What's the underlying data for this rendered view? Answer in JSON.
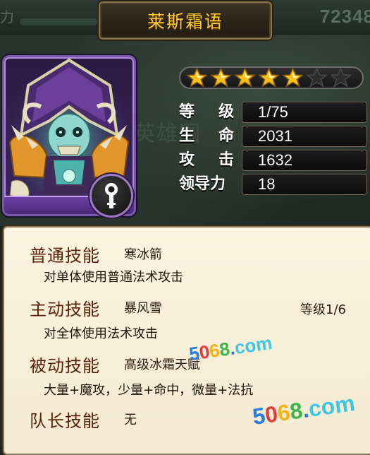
{
  "hero": {
    "name": "莱斯霜语",
    "star_count": 5,
    "star_max": 7
  },
  "stats": [
    {
      "label": "等级",
      "value": "1/75"
    },
    {
      "label": "生命",
      "value": "2031"
    },
    {
      "label": "攻击",
      "value": "1632"
    },
    {
      "label": "领导力",
      "value": "18"
    }
  ],
  "background": {
    "score": "72348",
    "tab_text": "英雄图",
    "top_left": "力"
  },
  "skills": {
    "normal": {
      "label": "普通技能",
      "name": "寒冰箭",
      "desc": "对单体使用普通法术攻击"
    },
    "active": {
      "label": "主动技能",
      "name": "暴风雪",
      "level": "等级1/6",
      "desc": "对全体使用法术攻击"
    },
    "passive": {
      "label": "被动技能",
      "name": "高级冰霜天赋",
      "desc": "大量+魔攻，少量+命中，微量+法抗"
    },
    "leader": {
      "label": "队长技能",
      "name": "无"
    }
  },
  "watermark": {
    "text": "5068.com"
  },
  "colors": {
    "title_gold": "#ffcc3a",
    "skill_label": "#5a1f08",
    "panel_bg": "#fbf4e0",
    "portrait_frame": "#7a58a8"
  },
  "icons": {
    "type_badge": "staff-icon",
    "star_filled": "gold-star-icon",
    "star_empty": "dark-star-icon"
  }
}
